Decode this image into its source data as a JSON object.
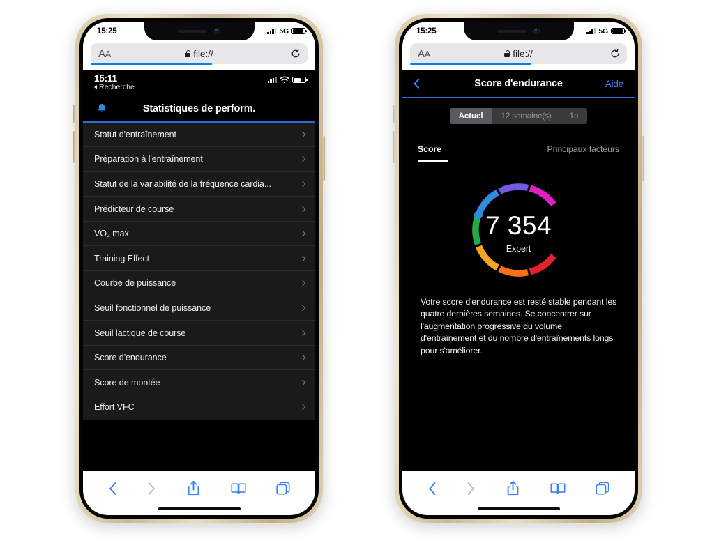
{
  "ios": {
    "status_time": "15:25",
    "network": "5G",
    "icons": {
      "signal": "signal-bars-icon",
      "battery": "battery-icon"
    }
  },
  "safari": {
    "aa_label": "AA",
    "url_text": "file://",
    "lock_icon": "lock-icon",
    "reload_icon": "reload-icon",
    "toolbar": {
      "back": "back-icon",
      "forward": "forward-icon",
      "share": "share-icon",
      "bookmarks": "bookmarks-icon",
      "tabs": "tabs-icon"
    }
  },
  "left_phone": {
    "app_status": {
      "time": "15:11",
      "back_label": "Recherche",
      "signal_icon": "signal-bars-icon",
      "wifi_icon": "wifi-icon",
      "battery_icon": "battery-icon"
    },
    "header": {
      "bell_icon": "bell-icon",
      "title": "Statistiques de perform."
    },
    "list_items": [
      {
        "label": "Statut d'entraînement"
      },
      {
        "label": "Préparation à l'entraînement"
      },
      {
        "label": "Statut de la variabilité de la fréquence cardia..."
      },
      {
        "label": "Prédicteur de course"
      },
      {
        "label": "VO₂ max"
      },
      {
        "label": "Training Effect"
      },
      {
        "label": "Courbe de puissance"
      },
      {
        "label": "Seuil fonctionnel de puissance"
      },
      {
        "label": "Seuil lactique de course"
      },
      {
        "label": "Score d'endurance"
      },
      {
        "label": "Score de montée"
      },
      {
        "label": "Effort VFC"
      }
    ]
  },
  "right_phone": {
    "nav": {
      "back_icon": "chevron-left-icon",
      "title": "Score d'endurance",
      "help_label": "Aide"
    },
    "segmented": {
      "options": [
        "Actuel",
        "12 semaine(s)",
        "1a"
      ],
      "selected": "Actuel"
    },
    "tabs": {
      "items": [
        "Score",
        "Principaux facteurs"
      ],
      "selected": "Score"
    },
    "gauge": {
      "value": "7 354",
      "level": "Expert",
      "marker_icon": "gauge-marker-dot",
      "segments": [
        {
          "name": "red",
          "color": "#e8212e"
        },
        {
          "name": "orange",
          "color": "#f97316"
        },
        {
          "name": "amber",
          "color": "#f5a524"
        },
        {
          "name": "green",
          "color": "#22a94b"
        },
        {
          "name": "blue",
          "color": "#2f8ae0"
        },
        {
          "name": "indigo",
          "color": "#6f5ae0"
        },
        {
          "name": "magenta",
          "color": "#e01fc4"
        }
      ],
      "marker_color": "#2f8ae0"
    },
    "description": "Votre score d'endurance est resté stable pendant les quatre dernières semaines. Se concentrer sur l'augmentation progressive du volume d'entraînement et du nombre d'entraînements longs pour s'améliorer."
  },
  "colors": {
    "accent_blue": "#3b82f6",
    "progress_blue": "#0a7cf5",
    "app_bg": "#000000",
    "list_bg": "#1a1a1a",
    "divider_blue": "#2f6bd8"
  }
}
